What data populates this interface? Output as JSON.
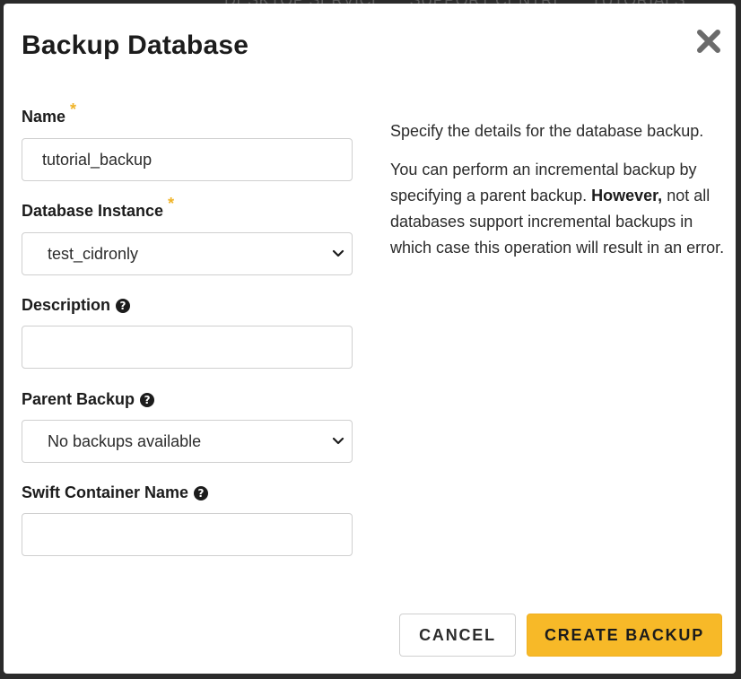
{
  "backdrop": {
    "nav_items": [
      "DESKTOP SERVICE",
      "SUPPORT CENTRE",
      "TUTORIALS"
    ]
  },
  "modal": {
    "title": "Backup Database",
    "close_icon": "close-icon",
    "fields": {
      "name": {
        "label": "Name",
        "required": "*",
        "value": "tutorial_backup"
      },
      "database_instance": {
        "label": "Database Instance",
        "required": "*",
        "value": "test_cidronly"
      },
      "description": {
        "label": "Description",
        "help_icon": "?",
        "value": ""
      },
      "parent_backup": {
        "label": "Parent Backup",
        "help_icon": "?",
        "value": "No backups available"
      },
      "swift_container_name": {
        "label": "Swift Container Name",
        "help_icon": "?",
        "value": ""
      }
    },
    "help": {
      "para1": "Specify the details for the database backup.",
      "para2_before": "You can perform an incremental backup by specifying a parent backup. ",
      "para2_bold": "However,",
      "para2_after": " not all databases support incremental backups in which case this operation will result in an error."
    },
    "buttons": {
      "cancel": "CANCEL",
      "create": "CREATE BACKUP"
    }
  },
  "colors": {
    "accent": "#f7b928",
    "required_star": "#f0b429",
    "text": "#1c1c1c"
  }
}
